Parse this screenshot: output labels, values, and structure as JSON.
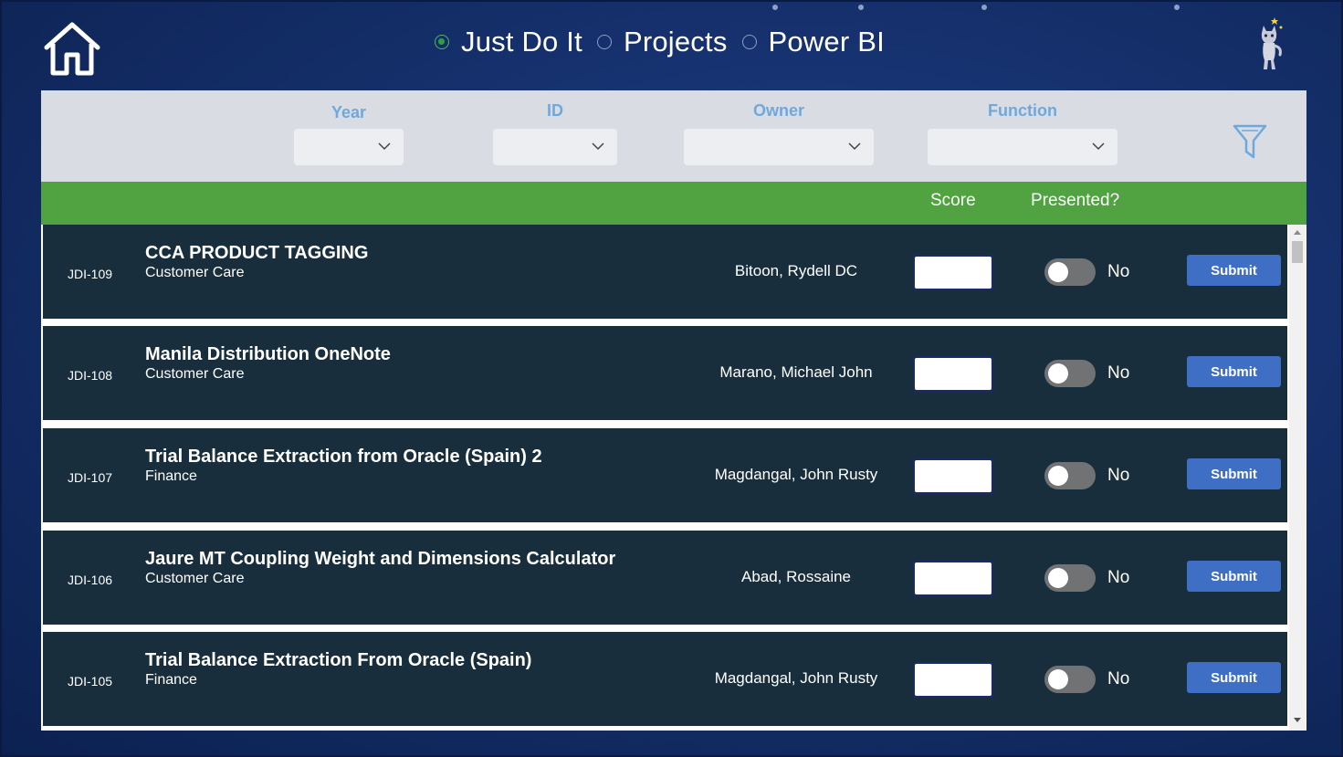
{
  "nav": {
    "items": [
      {
        "label": "Just Do It",
        "selected": true
      },
      {
        "label": "Projects",
        "selected": false
      },
      {
        "label": "Power BI",
        "selected": false
      }
    ]
  },
  "icons": {
    "home": "home-icon",
    "mascot": "mascot-icon",
    "filter": "filter-funnel-icon",
    "dropdown": "chevron-down-icon"
  },
  "filters": {
    "year": {
      "label": "Year",
      "value": ""
    },
    "id": {
      "label": "ID",
      "value": ""
    },
    "owner": {
      "label": "Owner",
      "value": ""
    },
    "function": {
      "label": "Function",
      "value": ""
    }
  },
  "table_header": {
    "score": "Score",
    "presented": "Presented?"
  },
  "rows": [
    {
      "id": "JDI-109",
      "title": "CCA PRODUCT TAGGING",
      "function": "Customer Care",
      "owner": "Bitoon, Rydell DC",
      "score": "",
      "presented": "No",
      "submit": "Submit"
    },
    {
      "id": "JDI-108",
      "title": "Manila Distribution OneNote",
      "function": "Customer Care",
      "owner": "Marano, Michael John",
      "score": "",
      "presented": "No",
      "submit": "Submit"
    },
    {
      "id": "JDI-107",
      "title": "Trial Balance Extraction from Oracle (Spain) 2",
      "function": "Finance",
      "owner": "Magdangal, John Rusty",
      "score": "",
      "presented": "No",
      "submit": "Submit"
    },
    {
      "id": "JDI-106",
      "title": "Jaure MT Coupling Weight and Dimensions Calculator",
      "function": "Customer Care",
      "owner": "Abad, Rossaine",
      "score": "",
      "presented": "No",
      "submit": "Submit"
    },
    {
      "id": "JDI-105",
      "title": "Trial Balance Extraction From Oracle (Spain)",
      "function": "Finance",
      "owner": "Magdangal, John Rusty",
      "score": "",
      "presented": "No",
      "submit": "Submit"
    }
  ],
  "colors": {
    "background": "#15306c",
    "filter_bar": "#d9dde3",
    "filter_label": "#6fa8dc",
    "header_bar": "#50a340",
    "row_bg": "#182e3d",
    "submit_button": "#3f6fc4",
    "radio_selected": "#2f9f47"
  }
}
